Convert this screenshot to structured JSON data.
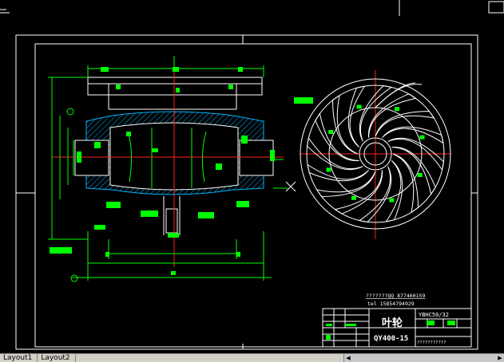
{
  "drawing": {
    "background": "#000000",
    "line_color": "#ffffff",
    "dimension_color": "#00ff00",
    "axis_color": "#ff2020",
    "hatch_color": "#00b4ff"
  },
  "title_block": {
    "company_line1": "???????QQ   877460159",
    "company_line2": "tel  15854794929",
    "part_name": "叶轮",
    "model_code": "YBHC50/32",
    "drawing_number": "QY400-15",
    "bottom_right": "???????????"
  },
  "tabs": {
    "layout1": "Layout1",
    "layout2": "Layout2"
  }
}
